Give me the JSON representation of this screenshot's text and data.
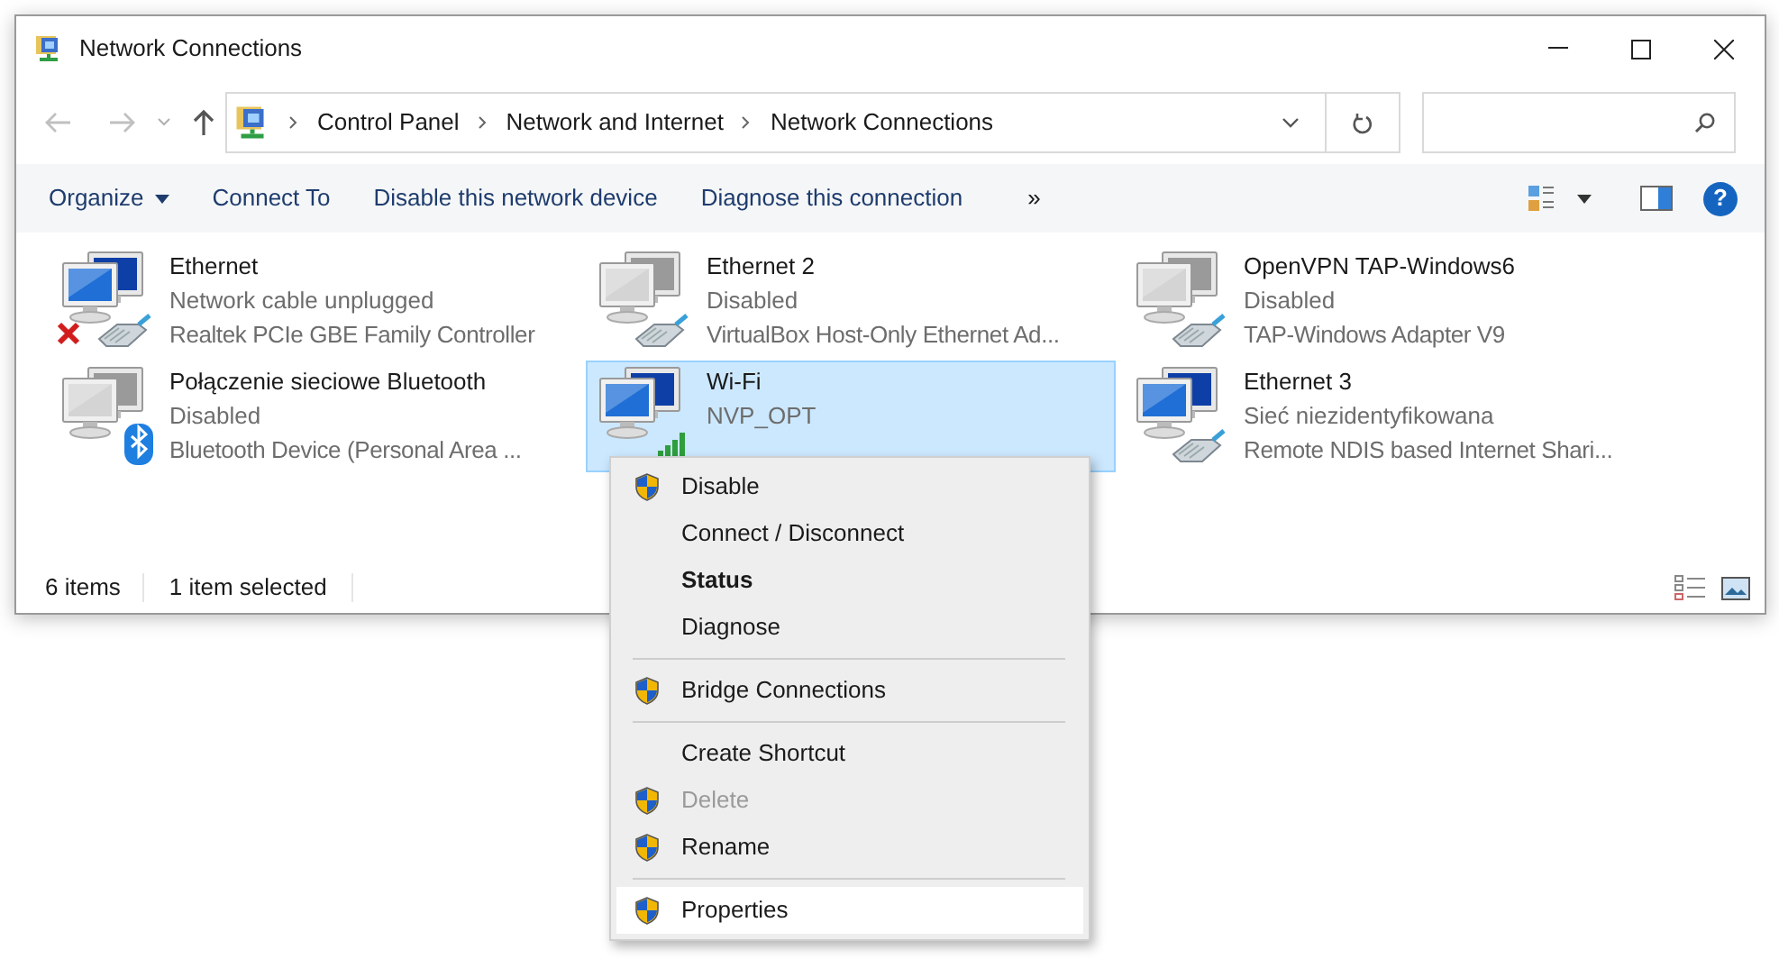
{
  "window": {
    "title": "Network Connections"
  },
  "address_bar": {
    "breadcrumbs": [
      "Control Panel",
      "Network and Internet",
      "Network Connections"
    ]
  },
  "toolbar": {
    "buttons": [
      {
        "label": "Organize",
        "dropdown": true
      },
      {
        "label": "Connect To",
        "dropdown": false
      },
      {
        "label": "Disable this network device",
        "dropdown": false
      },
      {
        "label": "Diagnose this connection",
        "dropdown": false
      }
    ],
    "overflow": "»",
    "help": "?"
  },
  "connections": [
    {
      "name": "Ethernet",
      "status": "Network cable unplugged",
      "device": "Realtek PCIe GBE Family Controller",
      "kind": "wired",
      "disabled": false,
      "unplugged": true,
      "selected": false
    },
    {
      "name": "Ethernet 2",
      "status": "Disabled",
      "device": "VirtualBox Host-Only Ethernet Ad...",
      "kind": "wired",
      "disabled": true,
      "unplugged": false,
      "selected": false
    },
    {
      "name": "OpenVPN TAP-Windows6",
      "status": "Disabled",
      "device": "TAP-Windows Adapter V9",
      "kind": "wired",
      "disabled": true,
      "unplugged": false,
      "selected": false
    },
    {
      "name": "Połączenie sieciowe Bluetooth",
      "status": "Disabled",
      "device": "Bluetooth Device (Personal Area ...",
      "kind": "bluetooth",
      "disabled": true,
      "unplugged": false,
      "selected": false
    },
    {
      "name": "Wi-Fi",
      "status": "NVP_OPT",
      "kind": "wifi",
      "disabled": false,
      "unplugged": false,
      "selected": true
    },
    {
      "name": "Ethernet 3",
      "status": "Sieć niezidentyfikowana",
      "device": "Remote NDIS based Internet Shari...",
      "kind": "wired",
      "disabled": false,
      "unplugged": false,
      "selected": false
    }
  ],
  "status_bar": {
    "item_count": "6 items",
    "selection": "1 item selected"
  },
  "context_menu": [
    {
      "kind": "item",
      "label": "Disable",
      "shield": true,
      "default": false,
      "disabled": false,
      "selected": false
    },
    {
      "kind": "item",
      "label": "Connect / Disconnect",
      "shield": false,
      "default": false,
      "disabled": false,
      "selected": false
    },
    {
      "kind": "item",
      "label": "Status",
      "shield": false,
      "default": true,
      "disabled": false,
      "selected": false
    },
    {
      "kind": "item",
      "label": "Diagnose",
      "shield": false,
      "default": false,
      "disabled": false,
      "selected": false
    },
    {
      "kind": "separator"
    },
    {
      "kind": "item",
      "label": "Bridge Connections",
      "shield": true,
      "default": false,
      "disabled": false,
      "selected": false
    },
    {
      "kind": "separator"
    },
    {
      "kind": "item",
      "label": "Create Shortcut",
      "shield": false,
      "default": false,
      "disabled": false,
      "selected": false
    },
    {
      "kind": "item",
      "label": "Delete",
      "shield": true,
      "default": false,
      "disabled": true,
      "selected": false
    },
    {
      "kind": "item",
      "label": "Rename",
      "shield": true,
      "default": false,
      "disabled": false,
      "selected": false
    },
    {
      "kind": "separator"
    },
    {
      "kind": "item",
      "label": "Properties",
      "shield": true,
      "default": false,
      "disabled": false,
      "selected": true
    }
  ]
}
